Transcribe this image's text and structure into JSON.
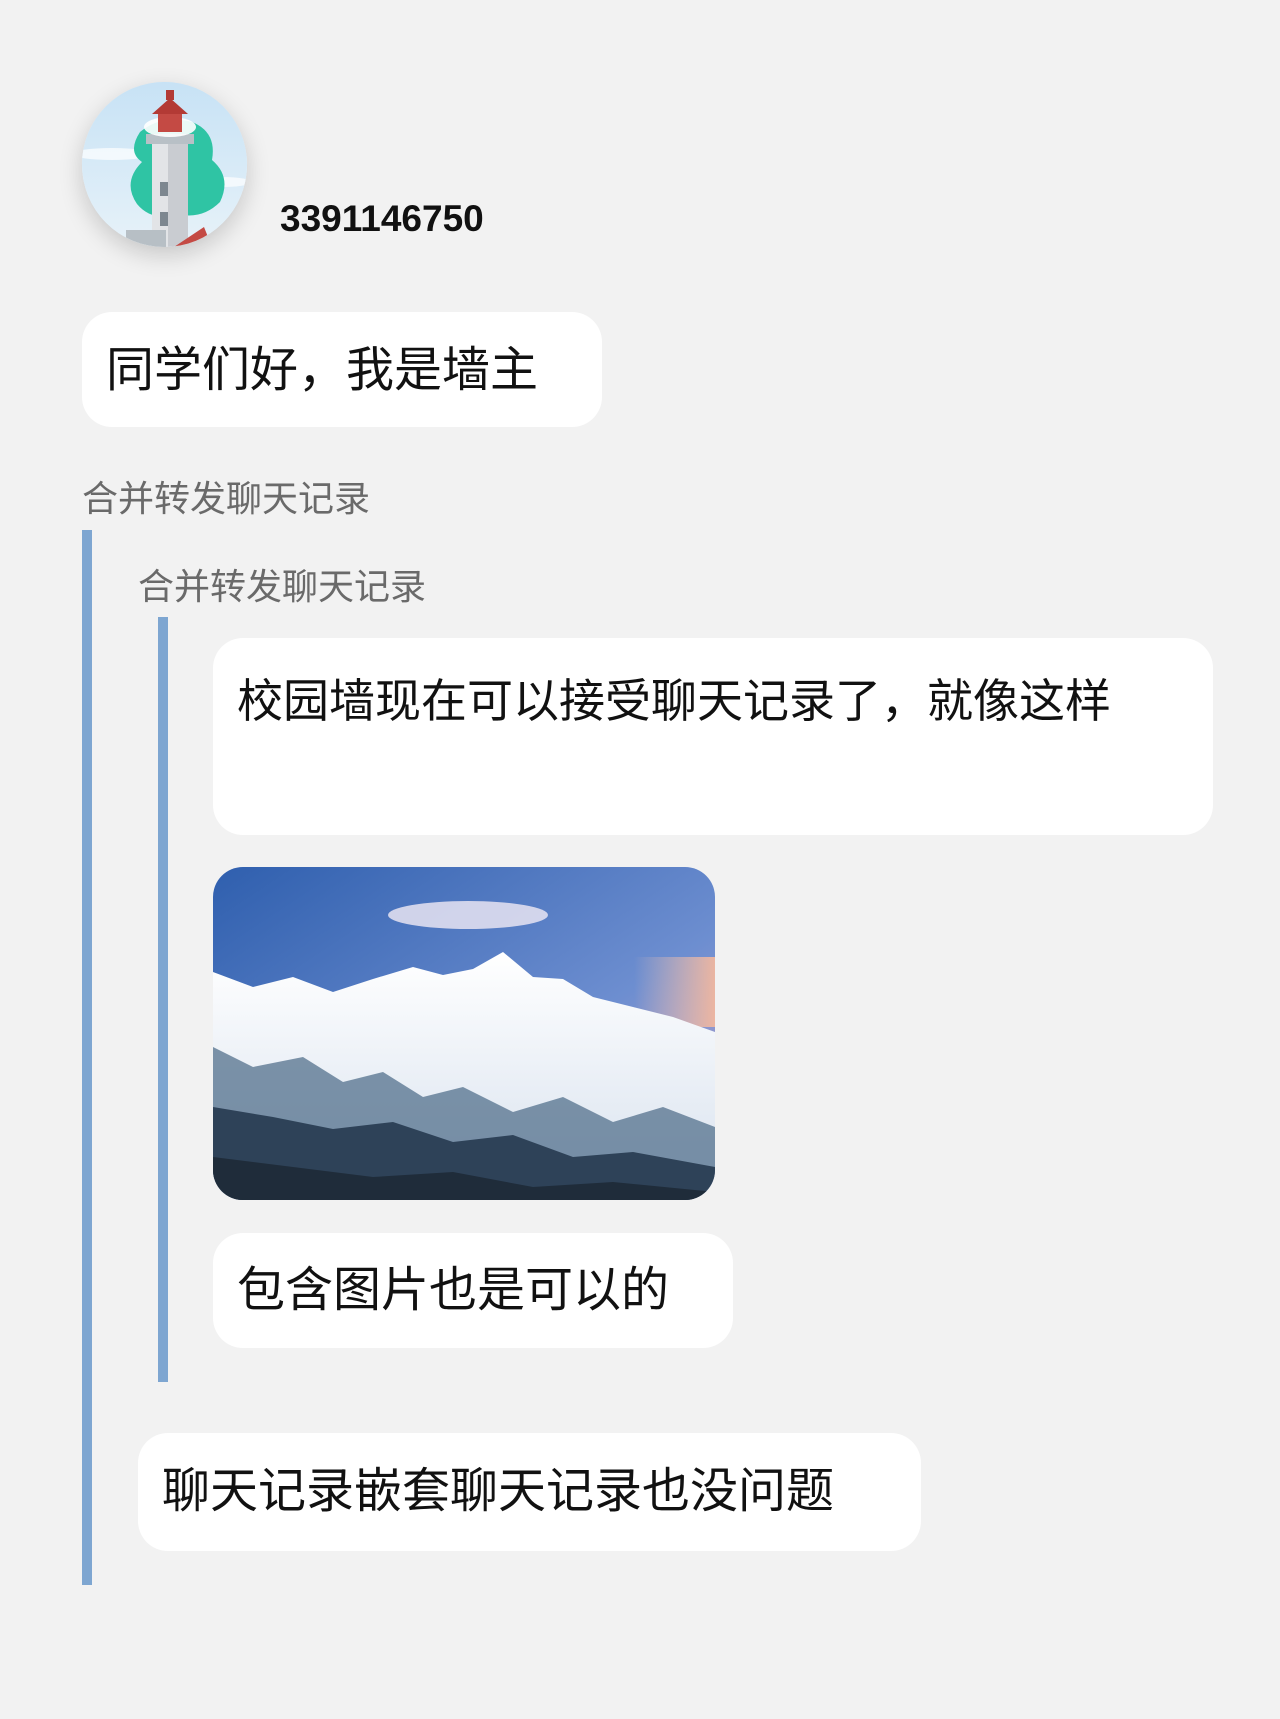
{
  "sender": {
    "name": "3391146750",
    "avatar_icon": "lighthouse-icon"
  },
  "messages": [
    {
      "text": "同学们好，我是墙主"
    }
  ],
  "forward": {
    "label": "合并转发聊天记录",
    "nested": {
      "label": "合并转发聊天记录",
      "messages": [
        {
          "text": "校园墙现在可以接受聊天记录了，就像这样"
        },
        {
          "text": "包含图片也是可以的"
        }
      ]
    },
    "messages": [
      {
        "text": "聊天记录嵌套聊天记录也没问题"
      }
    ]
  },
  "colors": {
    "background": "#f2f2f2",
    "bubble": "#ffffff",
    "quote_bar": "#7ea6d1",
    "forward_label": "#6a6a6a"
  }
}
